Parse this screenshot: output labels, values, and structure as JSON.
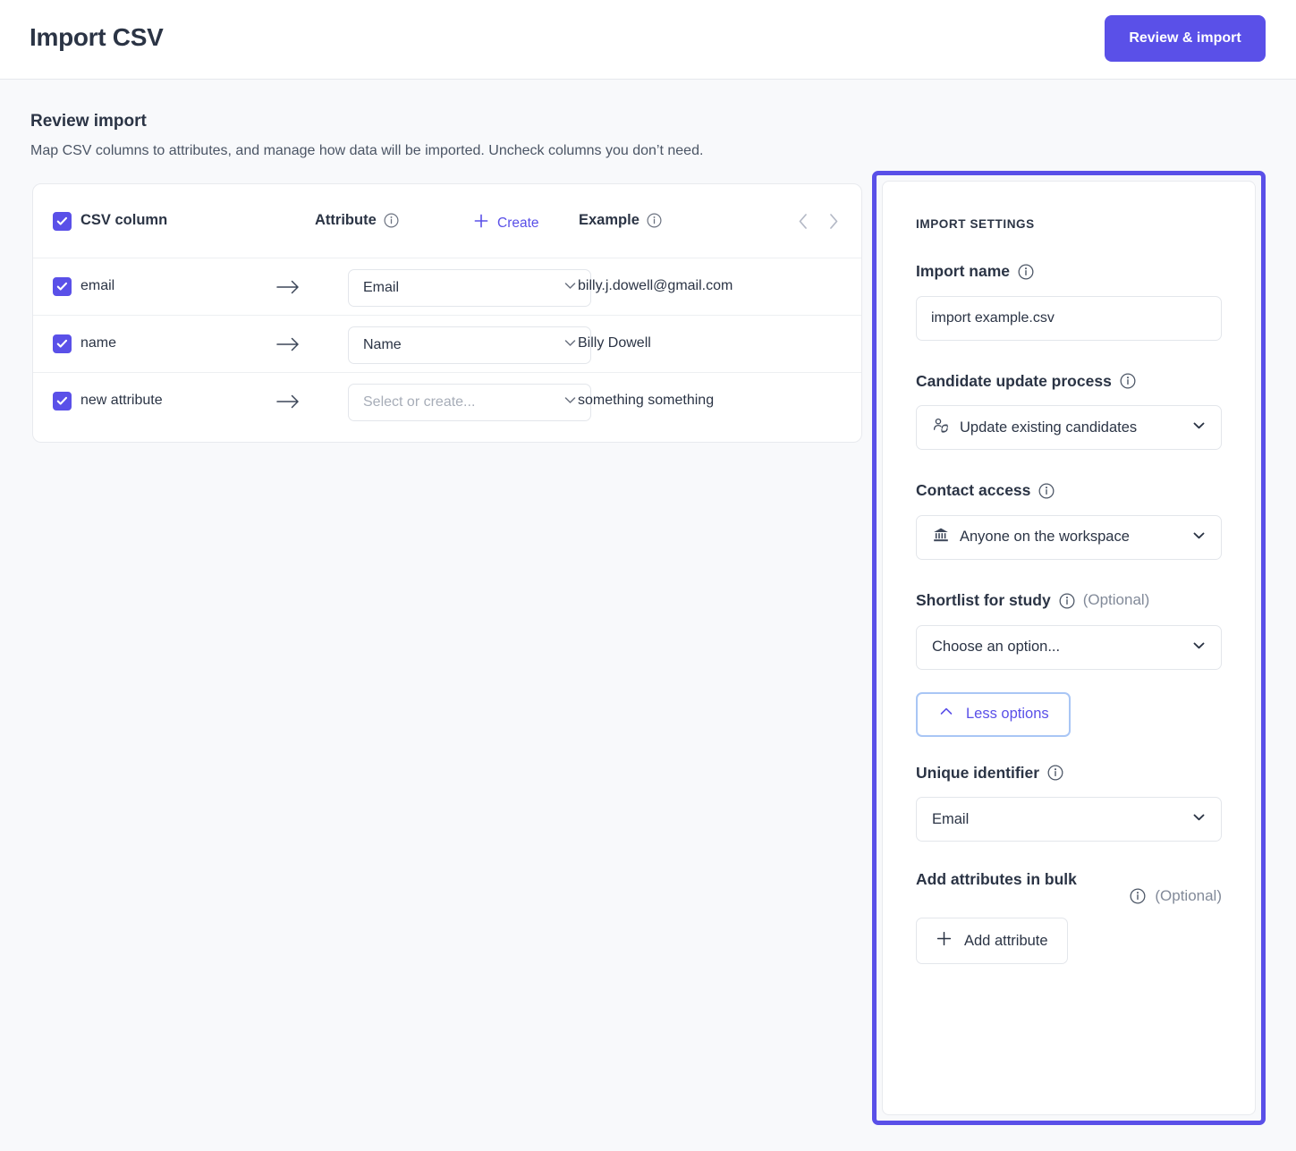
{
  "header": {
    "title": "Import CSV",
    "primary_button": "Review & import"
  },
  "review": {
    "title": "Review import",
    "description": "Map CSV columns to attributes, and manage how data will be imported. Uncheck columns you don’t need."
  },
  "table": {
    "columns": {
      "csv_column": "CSV column",
      "attribute": "Attribute",
      "create": "Create",
      "example": "Example"
    },
    "rows": [
      {
        "checked": true,
        "csv_column": "email",
        "attribute": "Email",
        "attribute_is_placeholder": false,
        "example": "billy.j.dowell@gmail.com"
      },
      {
        "checked": true,
        "csv_column": "name",
        "attribute": "Name",
        "attribute_is_placeholder": false,
        "example": "Billy Dowell"
      },
      {
        "checked": true,
        "csv_column": "new attribute",
        "attribute": "Select or create...",
        "attribute_is_placeholder": true,
        "example": "something something"
      }
    ]
  },
  "settings": {
    "kicker": "IMPORT SETTINGS",
    "import_name": {
      "label": "Import name",
      "value": "import example.csv",
      "placeholder": "Import name"
    },
    "candidate_update": {
      "label": "Candidate update process",
      "value": "Update existing candidates",
      "icon": "user-sync-icon"
    },
    "contact_access": {
      "label": "Contact access",
      "value": "Anyone on the workspace",
      "icon": "bank-icon"
    },
    "shortlist": {
      "label": "Shortlist for study",
      "optional": "(Optional)",
      "value": "Choose an option..."
    },
    "less_options_button": "Less options",
    "unique_identifier": {
      "label": "Unique identifier",
      "value": "Email"
    },
    "bulk_attributes": {
      "label": "Add attributes in bulk",
      "optional": "(Optional)",
      "button": "Add attribute"
    }
  },
  "colors": {
    "accent": "#5a50e8",
    "page_bg": "#f8f9fb",
    "text": "#2b3445",
    "muted": "#828a99",
    "focus_ring": "#a9c6f5"
  }
}
